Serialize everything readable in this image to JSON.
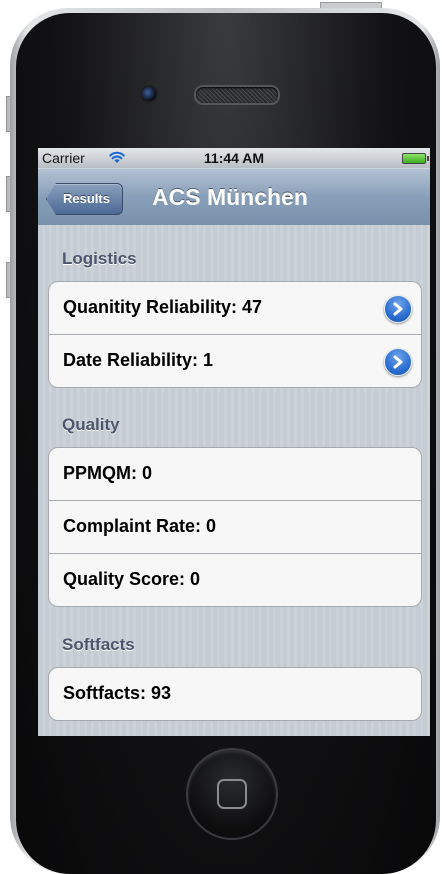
{
  "status_bar": {
    "carrier": "Carrier",
    "time": "11:44 AM"
  },
  "navbar": {
    "back_label": "Results",
    "title": "ACS München"
  },
  "sections": [
    {
      "header": "Logistics",
      "rows": [
        {
          "label": "Quanitity Reliability: 47",
          "has_disclosure": true
        },
        {
          "label": "Date Reliability: 1",
          "has_disclosure": true
        }
      ]
    },
    {
      "header": "Quality",
      "rows": [
        {
          "label": "PPMQM: 0",
          "has_disclosure": false
        },
        {
          "label": "Complaint Rate: 0",
          "has_disclosure": false
        },
        {
          "label": "Quality Score: 0",
          "has_disclosure": false
        }
      ]
    },
    {
      "header": "Softfacts",
      "rows": [
        {
          "label": "Softfacts: 93",
          "has_disclosure": false
        }
      ]
    }
  ],
  "colors": {
    "nav_bar": "#889fb9",
    "table_background": "#c5ccd4",
    "section_header_text": "#4c566c",
    "disclosure_button": "#2b6fd1"
  },
  "icons": [
    "wifi-icon",
    "battery-icon",
    "detail-disclosure-icon",
    "home-button"
  ]
}
